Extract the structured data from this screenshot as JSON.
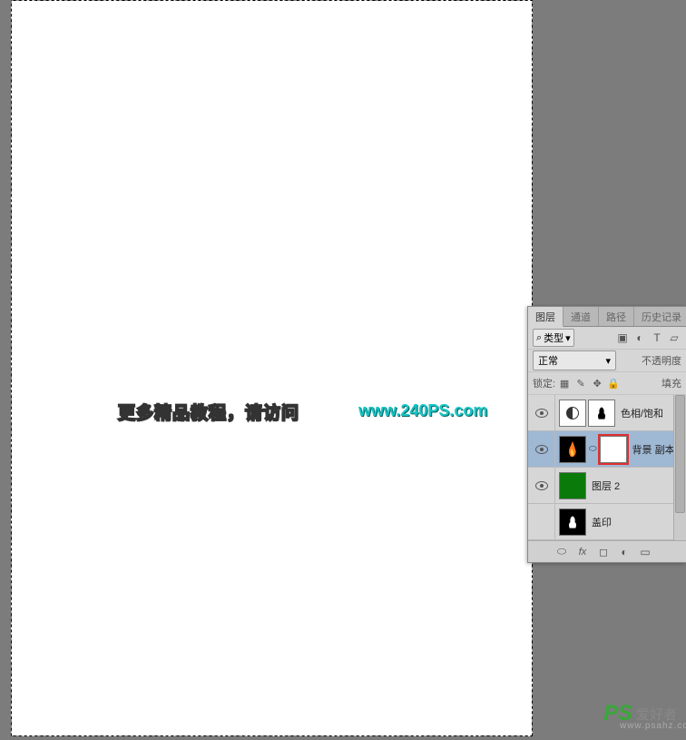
{
  "watermark": {
    "text": "更多精品教程，请访问",
    "url": "www.240PS.com"
  },
  "logo": {
    "ps": "PS",
    "cn": "爱好者",
    "domain": "www.psahz.com"
  },
  "panel": {
    "tabs": {
      "layers": "图层",
      "channels": "通道",
      "paths": "路径",
      "history": "历史记录"
    },
    "kind_label": "类型",
    "blend_mode": "正常",
    "opacity_label": "不透明度",
    "lock_label": "锁定:",
    "fill_label": "填充",
    "type_icons": {
      "image": "▣",
      "adjust": "◐",
      "text": "T",
      "shape": "▱"
    },
    "layers": [
      {
        "name": "色相/饱和",
        "type": "adjustment"
      },
      {
        "name": "背景 副本",
        "type": "masked"
      },
      {
        "name": "图层 2",
        "type": "solid"
      },
      {
        "name": "盖印",
        "type": "normal"
      }
    ],
    "footer": {
      "link": "⬭",
      "fx": "fx",
      "mask": "◻",
      "adjust": "◐",
      "group": "▭",
      "new": "◻"
    }
  }
}
